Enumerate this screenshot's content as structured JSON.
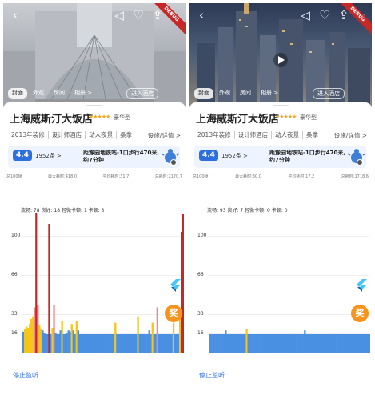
{
  "panels": [
    {
      "id": "left",
      "debug_label": "DEBUG",
      "tabs": [
        "封面",
        "外观",
        "房间",
        "相册 >",
        "进入酒店"
      ],
      "hotel_name": "上海威斯汀大饭店",
      "stars": "★★★★★",
      "star_label": "豪华型",
      "tags": [
        "2013年装修",
        "设计师酒店",
        "动人夜景",
        "桑拿"
      ],
      "facility_link": "设施/详情 >",
      "score": "4.4",
      "review_count": "1952条 >",
      "address": "距豫园地铁站-1口步行470米, 约7分钟",
      "stats": [
        "总100帧",
        "最大耗时:418.0",
        "平均耗时:31.7",
        "总耗时:2170.7"
      ],
      "frame_summary": "流畅: 78 良好: 18 轻微卡顿: 1 卡顿: 3",
      "y_axis": [
        "100",
        "66",
        "33",
        "16"
      ],
      "prize_label": "奖",
      "stop_label": "停止监听",
      "bars": [
        7,
        9,
        11,
        10,
        13,
        17,
        19,
        26,
        24,
        28,
        12,
        9,
        8,
        6,
        5,
        5,
        5,
        5,
        10,
        28,
        6,
        5,
        5,
        8,
        15,
        5,
        5,
        6,
        8,
        7,
        13,
        8,
        5,
        15,
        8,
        5,
        5,
        5,
        5,
        5,
        5,
        5,
        5,
        5,
        5,
        5,
        5,
        5,
        5,
        5,
        5,
        5,
        5,
        5,
        5,
        5,
        5,
        14,
        5,
        5,
        5,
        5,
        5,
        5,
        5,
        5,
        5,
        5,
        5,
        5,
        5,
        19,
        5,
        5,
        5,
        5,
        5,
        5,
        8,
        5,
        14,
        5,
        5,
        26,
        5,
        5,
        5,
        5,
        5,
        5,
        5,
        5,
        5,
        14,
        5,
        5,
        5,
        19,
        5,
        190
      ],
      "tall_bars": [
        {
          "index": 8,
          "value": 175
        },
        {
          "index": 16,
          "value": 162
        },
        {
          "index": 98,
          "value": 152
        }
      ]
    },
    {
      "id": "right",
      "debug_label": "DEBUG",
      "tabs": [
        "封面",
        "外观",
        "房间",
        "相册 >",
        "进入酒店"
      ],
      "hotel_name": "上海威斯汀大饭店",
      "stars": "★★★★★",
      "star_label": "豪华型",
      "tags": [
        "2013年装修",
        "设计师酒店",
        "动人夜景",
        "桑拿"
      ],
      "facility_link": "设施/详情 >",
      "score": "4.4",
      "review_count": "1952条 >",
      "address": "距豫园地铁站-1口步行470米, 约7分钟",
      "stats": [
        "总100帧",
        "最大耗时:30.0",
        "平均耗时:17.2",
        "总耗时:1718.6"
      ],
      "frame_summary": "流畅: 93 良好: 7 轻微卡顿: 0 卡顿: 0",
      "y_axis": [
        "100",
        "66",
        "33",
        "16"
      ],
      "prize_label": "奖",
      "stop_label": "停止监听",
      "bars": [
        5,
        5,
        5,
        5,
        5,
        5,
        5,
        5,
        5,
        5,
        8,
        5,
        5,
        5,
        5,
        5,
        5,
        5,
        5,
        5,
        5,
        5,
        5,
        9,
        5,
        5,
        5,
        5,
        5,
        5,
        5,
        5,
        5,
        5,
        5,
        5,
        5,
        5,
        5,
        5,
        5,
        5,
        5,
        5,
        5,
        5,
        5,
        5,
        5,
        5,
        5,
        5,
        5,
        5,
        5,
        5,
        5,
        5,
        5,
        8,
        5,
        5,
        5,
        5,
        5,
        5,
        5,
        5,
        5,
        5,
        5,
        5,
        5,
        5,
        5,
        5,
        5,
        5,
        5,
        5,
        5,
        5,
        5,
        5,
        5,
        5,
        5,
        5,
        5,
        5,
        5,
        5,
        5,
        5,
        5,
        5,
        5,
        5,
        5,
        5
      ],
      "tall_bars": []
    }
  ],
  "colors": {
    "smooth": "#4a90e2",
    "good": "#f5c518",
    "minor": "#f08a8a",
    "jank": "#c62828",
    "accent": "#2e6fe0",
    "prize": "#f7941d"
  },
  "icons": [
    "back-icon",
    "mute-icon",
    "heart-icon",
    "share-icon",
    "more-icon",
    "bug-icon",
    "flutter-icon"
  ]
}
